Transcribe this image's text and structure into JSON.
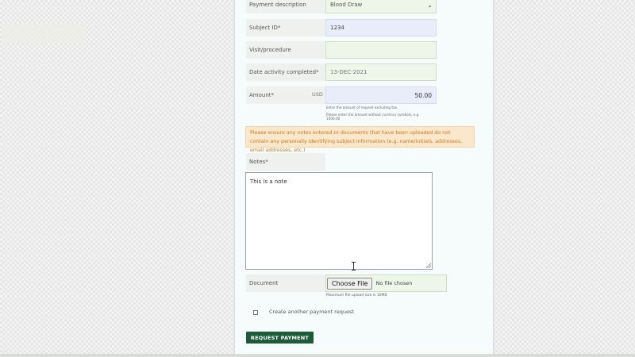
{
  "form": {
    "payment_description": {
      "label": "Payment description",
      "value": "Blood Draw"
    },
    "subject_id": {
      "label": "Subject ID*",
      "value": "1234"
    },
    "visit_procedure": {
      "label": "Visit/procedure",
      "value": ""
    },
    "date_completed": {
      "label": "Date activity completed*",
      "value": "13-DEC-2021"
    },
    "amount": {
      "label": "Amount*",
      "currency": "USD",
      "value": "50.00",
      "help_line1": "Enter the amount of request excluding tax.",
      "help_line2": "Please enter the amount without currency symbols, e.g.",
      "help_line3": "1000.00"
    },
    "warning": "Please ensure any notes entered or documents that have been uploaded do not contain any personally identifying subject information (e.g. name/initials, addresses, email addresses, etc.)",
    "notes": {
      "label": "Notes*",
      "value": "This is a note"
    },
    "document": {
      "label": "Document",
      "button_label": "Choose File",
      "status": "No file chosen",
      "max_size": "Maximum file upload size is 10MB"
    },
    "create_another": {
      "label": "Create another payment request",
      "checked": false
    },
    "submit_label": "REQUEST PAYMENT"
  },
  "colors": {
    "submit_bg": "#1d5c38",
    "warning_bg": "#fbe7cc",
    "warning_text": "#d0781e"
  }
}
